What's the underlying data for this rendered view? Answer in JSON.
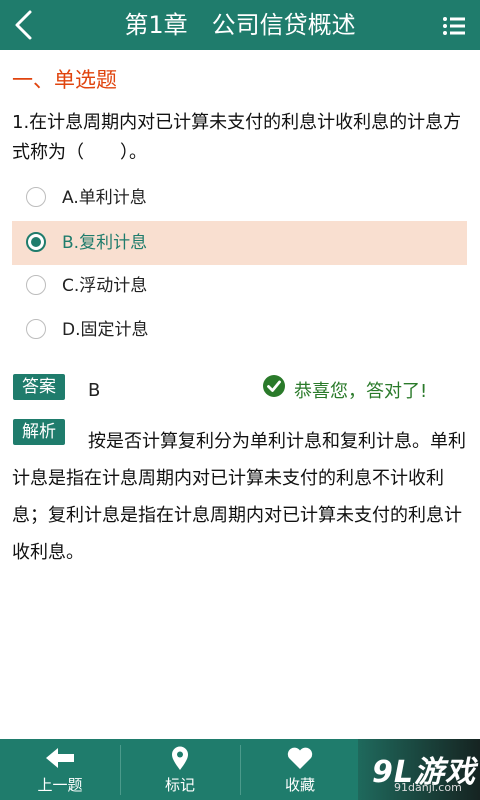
{
  "header": {
    "title": "第1章　公司信贷概述"
  },
  "section_title": "一、单选题",
  "question": "1.在计息周期内对已计算未支付的利息计收利息的计息方式称为（　　）。",
  "options": [
    {
      "label": "A.单利计息",
      "selected": false
    },
    {
      "label": "B.复利计息",
      "selected": true
    },
    {
      "label": "C.浮动计息",
      "selected": false
    },
    {
      "label": "D.固定计息",
      "selected": false
    }
  ],
  "answer": {
    "tag": "答案",
    "value": "B",
    "result": "恭喜您，答对了!"
  },
  "analysis": {
    "tag": "解析",
    "text": "按是否计算复利分为单利计息和复利计息。单利计息是指在计息周期内对已计算未支付的利息不计收利息；复利计息是指在计息周期内对已计算未支付的利息计收利息。"
  },
  "bottom_nav": [
    {
      "label": "上一题",
      "icon": "arrow-left-icon"
    },
    {
      "label": "标记",
      "icon": "map-pin-icon"
    },
    {
      "label": "收藏",
      "icon": "heart-icon"
    }
  ],
  "watermark": {
    "logo": "9L游戏",
    "site": "91danji.com"
  },
  "colors": {
    "primary": "#1f7c6c",
    "section": "#e0440e",
    "selected_bg": "#f9dfd0",
    "correct": "#2a7a2a"
  }
}
